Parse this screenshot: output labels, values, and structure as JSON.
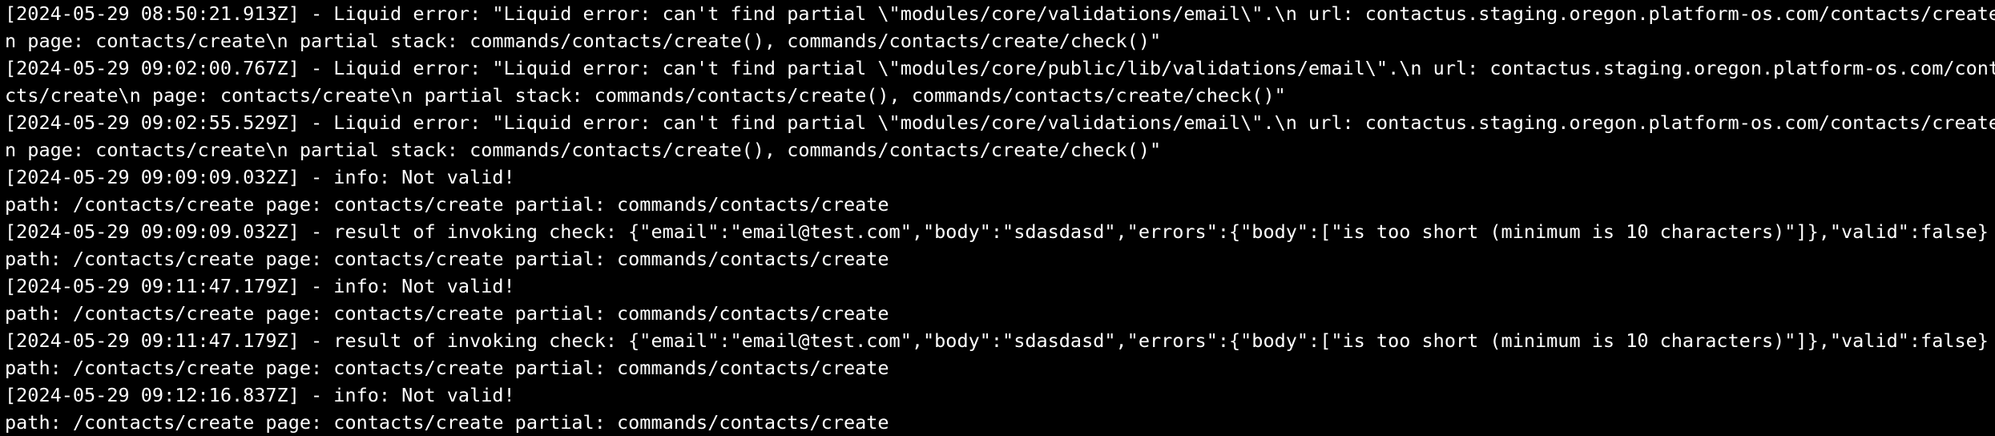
{
  "terminal": {
    "lines": [
      "[2024-05-29 08:50:21.913Z] - Liquid error: \"Liquid error: can't find partial \\\"modules/core/validations/email\\\".\\n url: contactus.staging.oregon.platform-os.com/contacts/create\\",
      "n page: contacts/create\\n partial stack: commands/contacts/create(), commands/contacts/create/check()\"",
      "[2024-05-29 09:02:00.767Z] - Liquid error: \"Liquid error: can't find partial \\\"modules/core/public/lib/validations/email\\\".\\n url: contactus.staging.oregon.platform-os.com/conta",
      "cts/create\\n page: contacts/create\\n partial stack: commands/contacts/create(), commands/contacts/create/check()\"",
      "[2024-05-29 09:02:55.529Z] - Liquid error: \"Liquid error: can't find partial \\\"modules/core/validations/email\\\".\\n url: contactus.staging.oregon.platform-os.com/contacts/create\\",
      "n page: contacts/create\\n partial stack: commands/contacts/create(), commands/contacts/create/check()\"",
      "[2024-05-29 09:09:09.032Z] - info: Not valid!",
      "path: /contacts/create page: contacts/create partial: commands/contacts/create",
      "[2024-05-29 09:09:09.032Z] - result of invoking check: {\"email\":\"email@test.com\",\"body\":\"sdasdasd\",\"errors\":{\"body\":[\"is too short (minimum is 10 characters)\"]},\"valid\":false}",
      "path: /contacts/create page: contacts/create partial: commands/contacts/create",
      "[2024-05-29 09:11:47.179Z] - info: Not valid!",
      "path: /contacts/create page: contacts/create partial: commands/contacts/create",
      "[2024-05-29 09:11:47.179Z] - result of invoking check: {\"email\":\"email@test.com\",\"body\":\"sdasdasd\",\"errors\":{\"body\":[\"is too short (minimum is 10 characters)\"]},\"valid\":false}",
      "path: /contacts/create page: contacts/create partial: commands/contacts/create",
      "[2024-05-29 09:12:16.837Z] - info: Not valid!",
      "path: /contacts/create page: contacts/create partial: commands/contacts/create"
    ],
    "colors": {
      "background": "#000000",
      "text": "#ffffff"
    }
  }
}
